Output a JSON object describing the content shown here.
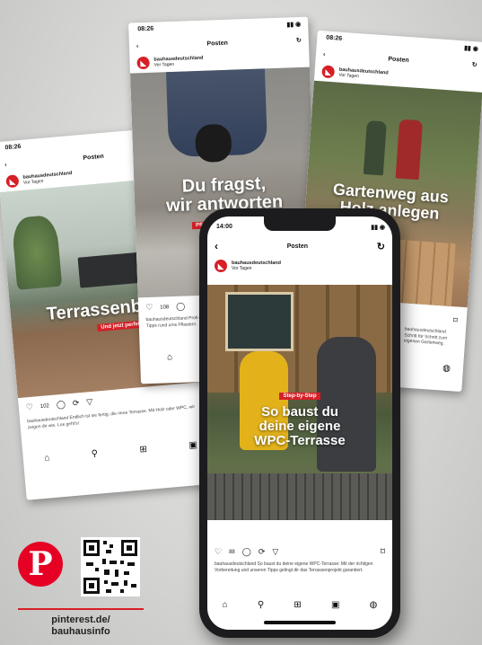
{
  "header": {
    "posts_label": "Posten"
  },
  "account": {
    "name": "bauhausdeutschland",
    "date": "Vor Tagen"
  },
  "cards": [
    {
      "time": "08:26",
      "title": "Terrassenbo",
      "tag": "Und jetzt perfekt",
      "likes": "102",
      "caption": "bauhausdeutschland Endlich ist sie fertig: die neue Terrasse. Mit Holz oder WPC, wir zeigen dir wie. Los geht's!"
    },
    {
      "time": "08:26",
      "title_line1": "Du fragst,",
      "title_line2": "wir antworten",
      "tag": "Pflastersteine verlegen",
      "likes": "108",
      "caption": "bauhausdeutschland Profi-Tipps rund ums Pflastern."
    },
    {
      "time": "08:26",
      "title_line1": "Gartenweg aus",
      "title_line2": "Holz anlegen",
      "caption": "bauhausdeutschland Schritt für Schritt zum eigenen Gartenweg."
    }
  ],
  "phone": {
    "time": "14:00",
    "badge": "Step-by-Step",
    "title_line1": "So baust du",
    "title_line2": "deine eigene",
    "title_line3": "WPC-Terrasse",
    "likes": "88",
    "caption": "bauhausdeutschland So baust du deine eigene WPC-Terrasse: Mit der richtigen Vorbereitung und unseren Tipps gelingt dir das Terrassenprojekt garantiert."
  },
  "promo": {
    "logo_letter": "P",
    "url_line1": "pinterest.de/",
    "url_line2": "bauhausinfo"
  },
  "icons": [
    "heart-icon",
    "comment-icon",
    "share-icon",
    "send-icon",
    "bookmark-icon",
    "home-icon",
    "search-icon",
    "add-icon",
    "shop-icon",
    "profile-icon",
    "back-icon",
    "refresh-icon"
  ],
  "colors": {
    "brand_red": "#d61f26",
    "pinterest_red": "#e60023"
  }
}
